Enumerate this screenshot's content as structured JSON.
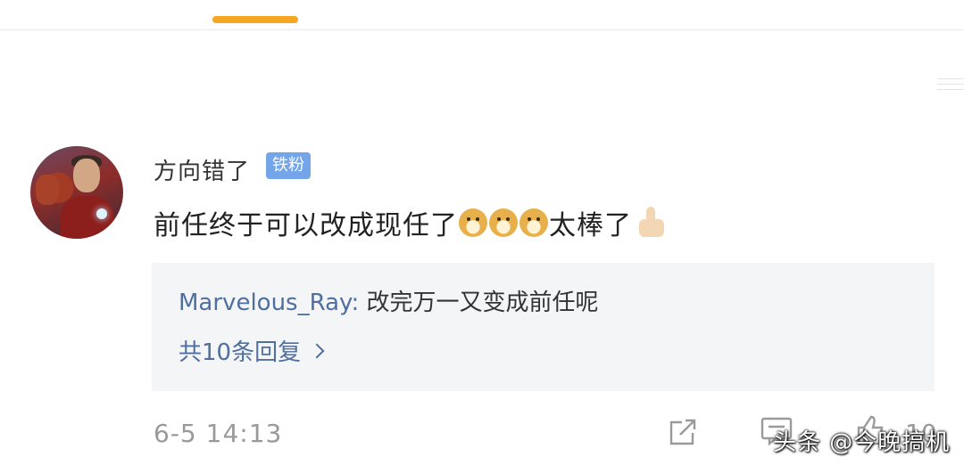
{
  "comment": {
    "username": "方向错了",
    "badge": "铁粉",
    "text_main": "前任终于可以改成现任了",
    "emoji_1": "doge",
    "emoji_2": "doge",
    "emoji_3": "doge",
    "text_after": "太棒了",
    "emoji_end": "thumbs-up",
    "timestamp": "6-5 14:13",
    "like_count": "10"
  },
  "reply_preview": {
    "username": "Marvelous_Ray",
    "separator": ": ",
    "text": "改完万一又变成前任呢",
    "count_label": "共10条回复"
  },
  "actions": {
    "share_icon": "share-icon",
    "comment_icon": "comment-icon",
    "like_icon": "thumb-up-icon"
  },
  "watermark": "头条 @今晚搞机",
  "colors": {
    "tab_accent": "#f5a623",
    "badge_bg": "#74a5e8",
    "link_blue": "#4f6f9f",
    "reply_bg": "#f4f5f7"
  }
}
